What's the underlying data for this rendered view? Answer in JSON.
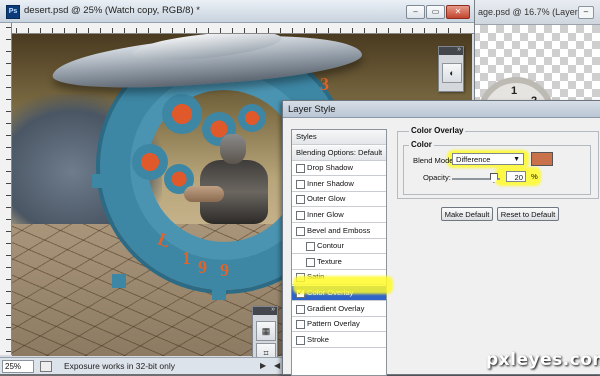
{
  "back_window": {
    "title": "age.psd @ 16.7% (Layer ...",
    "minimize_label": "–",
    "clock_numbers": [
      "2",
      "1"
    ]
  },
  "doc_window": {
    "app_icon": "Ps",
    "title": "desert.psd @ 25% (Watch copy, RGB/8) *",
    "minimize_label": "–",
    "maximize_label": "▭",
    "close_label": "✕"
  },
  "artwork": {
    "gear_numbers": [
      "3",
      "4",
      "L",
      "1",
      "6",
      "9"
    ]
  },
  "statusbar": {
    "zoom": "25%",
    "message": "Exposure works in 32-bit only",
    "arrow": "▶",
    "scroll_left": "◀"
  },
  "tool_panels": {
    "top_grip": "»",
    "top_tool_icon": "◐",
    "bottom_grip": "»",
    "bottom_tools": [
      "▦",
      "⌗"
    ]
  },
  "dialog": {
    "title": "Layer Style",
    "styles_list": [
      {
        "label": "Styles",
        "checkbox": false,
        "indent": 0,
        "header": true
      },
      {
        "label": "Blending Options: Default",
        "checkbox": false,
        "indent": 0,
        "header": true
      },
      {
        "label": "Drop Shadow",
        "checkbox": true,
        "checked": false,
        "indent": 0
      },
      {
        "label": "Inner Shadow",
        "checkbox": true,
        "checked": false,
        "indent": 0
      },
      {
        "label": "Outer Glow",
        "checkbox": true,
        "checked": false,
        "indent": 0
      },
      {
        "label": "Inner Glow",
        "checkbox": true,
        "checked": false,
        "indent": 0
      },
      {
        "label": "Bevel and Emboss",
        "checkbox": true,
        "checked": false,
        "indent": 0
      },
      {
        "label": "Contour",
        "checkbox": true,
        "checked": false,
        "indent": 1
      },
      {
        "label": "Texture",
        "checkbox": true,
        "checked": false,
        "indent": 1
      },
      {
        "label": "Satin",
        "checkbox": true,
        "checked": false,
        "indent": 0
      },
      {
        "label": "Color Overlay",
        "checkbox": true,
        "checked": true,
        "indent": 0,
        "selected": true
      },
      {
        "label": "Gradient Overlay",
        "checkbox": true,
        "checked": false,
        "indent": 0
      },
      {
        "label": "Pattern Overlay",
        "checkbox": true,
        "checked": false,
        "indent": 0
      },
      {
        "label": "Stroke",
        "checkbox": true,
        "checked": false,
        "indent": 0
      }
    ],
    "section_title": "Color Overlay",
    "group_title": "Color",
    "blend_mode_label": "Blend Mode:",
    "blend_mode_value": "Difference",
    "overlay_color": "#c8714a",
    "opacity_label": "Opacity:",
    "opacity_value": "20",
    "opacity_fraction": 0.2,
    "opacity_unit": "%",
    "make_default_label": "Make Default",
    "reset_default_label": "Reset to Default"
  },
  "watermark": "pxleyes.com",
  "colors": {
    "selection_blue": "#2f63c8",
    "highlight_yellow": "#fffa28",
    "gear_teal": "#3d86a4",
    "gear_orange": "#e0642a"
  }
}
